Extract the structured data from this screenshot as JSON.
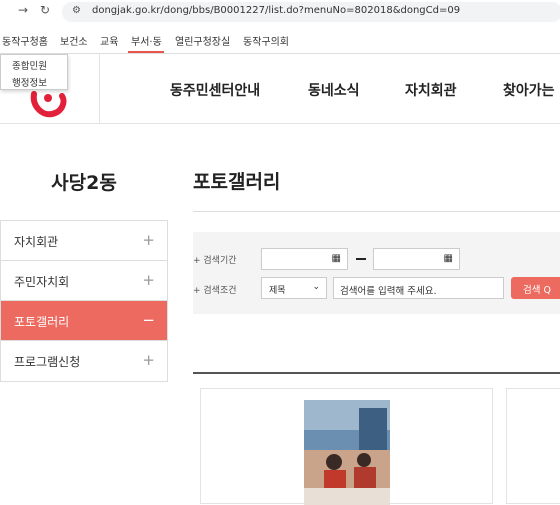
{
  "browser": {
    "url": "dongjak.go.kr/dong/bbs/B0001227/list.do?menuNo=802018&dongCd=09",
    "forward_icon": "→",
    "reload_icon": "↻",
    "site_info_icon": "⚙"
  },
  "gnb": [
    "동작구청홈",
    "보건소",
    "교육",
    "부서·동",
    "열린구청장실",
    "동작구의회"
  ],
  "dropdown": [
    "종합민원",
    "행정정보"
  ],
  "header_menu": [
    "동주민센터안내",
    "동네소식",
    "자치회관",
    "찾아가는"
  ],
  "side": {
    "title": "사당2동",
    "items": [
      {
        "label": "자치회관",
        "sign": "+"
      },
      {
        "label": "주민자치회",
        "sign": "+"
      },
      {
        "label": "포토갤러리",
        "sign": "−"
      },
      {
        "label": "프로그램신청",
        "sign": "+"
      }
    ]
  },
  "content": {
    "title": "포토갤러리",
    "search": {
      "period_label": "+ 검색기간",
      "condition_label": "+ 검색조건",
      "select_value": "제목",
      "keyword_placeholder": "검색어를 입력해 주세요.",
      "button_label": "검색 Q"
    }
  },
  "colors": {
    "accent": "#ec6a5f"
  }
}
